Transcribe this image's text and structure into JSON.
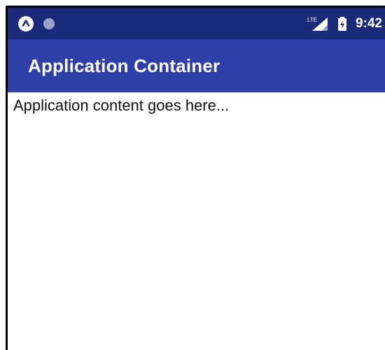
{
  "status_bar": {
    "left_icons": [
      "app-notification-icon",
      "dot-notification-icon"
    ],
    "network_label": "LTE",
    "time": "9:42",
    "right_icons": [
      "signal-icon",
      "battery-icon"
    ]
  },
  "app_bar": {
    "title": "Application Container"
  },
  "main": {
    "content_text": "Application content goes here..."
  },
  "colors": {
    "status_bar_bg": "#1c2a7a",
    "app_bar_bg": "#2f3fa8",
    "content_bg": "#ffffff"
  }
}
